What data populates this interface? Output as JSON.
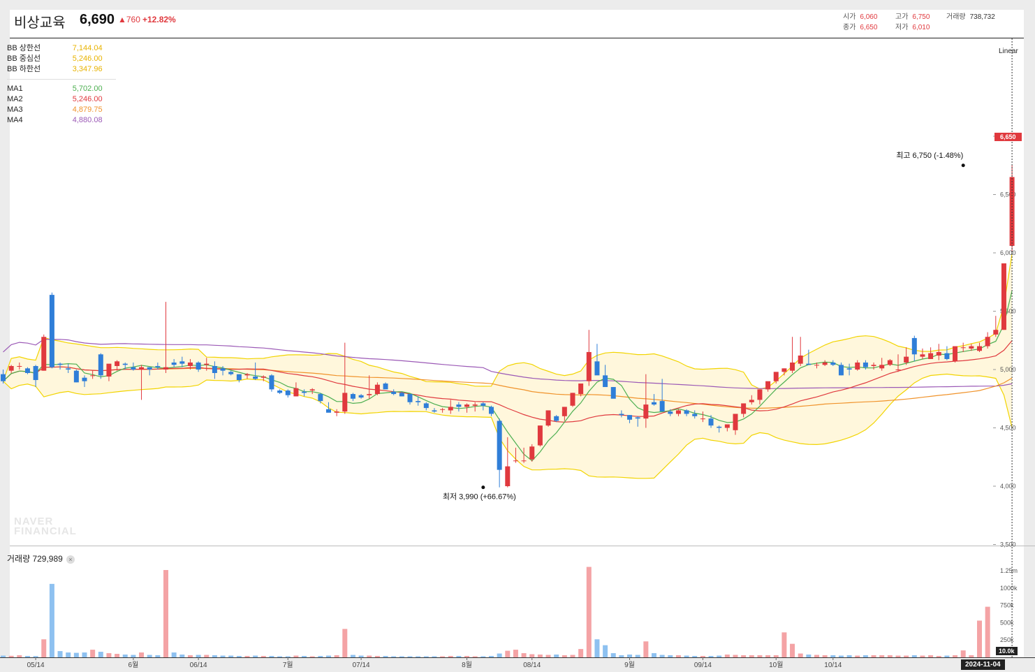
{
  "header": {
    "name": "비상교육",
    "price": "6,690",
    "change": "▲760",
    "change_pct": "+12.82%",
    "open_label": "시가",
    "open": "6,060",
    "high_label": "고가",
    "high": "6,750",
    "volume_label": "거래량",
    "volume": "738,732",
    "close_label": "종가",
    "close": "6,650",
    "low_label": "저가",
    "low": "6,010"
  },
  "legend": {
    "bb": [
      {
        "label": "BB 상한선",
        "value": "7,144.04",
        "color": "#e8b300"
      },
      {
        "label": "BB 중심선",
        "value": "5,246.00",
        "color": "#e8b300"
      },
      {
        "label": "BB 하한선",
        "value": "3,347.96",
        "color": "#e8b300"
      }
    ],
    "ma": [
      {
        "label": "MA1",
        "value": "5,702.00",
        "color": "#4caf50"
      },
      {
        "label": "MA2",
        "value": "5,246.00",
        "color": "#e0393e"
      },
      {
        "label": "MA3",
        "value": "4,879.75",
        "color": "#f0932b"
      },
      {
        "label": "MA4",
        "value": "4,880.08",
        "color": "#9b59b6"
      }
    ]
  },
  "scale_label": "Linear",
  "volume_panel": {
    "title": "거래량 729,989",
    "close": "×"
  },
  "watermark": [
    "NAVER",
    "FINANCIAL"
  ],
  "date_tag": "2024-11-04",
  "vol_tag": "10.0k",
  "price_tag": "6,650",
  "colors": {
    "up": "#e0393e",
    "down": "#2f7ed8",
    "up_vol": "#f4a3a5",
    "down_vol": "#8ec1f0",
    "bb": "#f2d400",
    "bb_fill": "#fff7dc"
  },
  "chart_data": {
    "type": "candlestick",
    "y_ticks": [
      "7,000",
      "6,500",
      "6,000",
      "5,500",
      "5,000",
      "4,500",
      "4,000",
      "3,500"
    ],
    "y_tick_values": [
      7000,
      6500,
      6000,
      5500,
      5000,
      4500,
      4000,
      3500
    ],
    "x_ticks": [
      "05/14",
      "6월",
      "06/14",
      "7월",
      "07/14",
      "8월",
      "08/14",
      "9월",
      "09/14",
      "10월",
      "10/14"
    ],
    "x_tick_index": [
      4,
      16,
      24,
      35,
      44,
      57,
      65,
      77,
      86,
      95,
      102
    ],
    "vol_ticks": [
      "1.25m",
      "1000k",
      "750k",
      "500k",
      "250k"
    ],
    "vol_tick_values": [
      1250000,
      1000000,
      750000,
      500000,
      250000
    ],
    "annotations": [
      {
        "text": "최고 6,750 (-1.48%)",
        "index": 118,
        "value": 6750
      },
      {
        "text": "최저 3,990 (+66.67%)",
        "index": 59,
        "value": 3990
      }
    ],
    "candles": [
      [
        4960,
        5000,
        4880,
        4900
      ],
      [
        4990,
        5040,
        4970,
        5030
      ],
      [
        5030,
        5060,
        5000,
        5030
      ],
      [
        5010,
        5020,
        4960,
        4970
      ],
      [
        5030,
        5040,
        4850,
        4910
      ],
      [
        4990,
        5300,
        4990,
        5280
      ],
      [
        5640,
        5660,
        5010,
        5020
      ],
      [
        5050,
        5060,
        5000,
        5040
      ],
      [
        5010,
        5050,
        4970,
        5000
      ],
      [
        4990,
        5000,
        4890,
        4890
      ],
      [
        4930,
        4950,
        4850,
        4900
      ],
      [
        4950,
        4990,
        4920,
        4950
      ],
      [
        5130,
        5140,
        4920,
        4950
      ],
      [
        4940,
        5040,
        4900,
        5050
      ],
      [
        5030,
        5080,
        4990,
        5070
      ],
      [
        5050,
        5060,
        5000,
        5040
      ],
      [
        5020,
        5060,
        4990,
        5000
      ],
      [
        5000,
        5040,
        4740,
        5020
      ],
      [
        5020,
        5020,
        4950,
        5000
      ],
      [
        5030,
        5060,
        5000,
        5020
      ],
      [
        5000,
        5580,
        4970,
        5020
      ],
      [
        5060,
        5090,
        5020,
        5040
      ],
      [
        5070,
        5110,
        5020,
        5050
      ],
      [
        5030,
        5090,
        5000,
        5060
      ],
      [
        5060,
        5070,
        4980,
        5000
      ],
      [
        5040,
        5100,
        4990,
        5050
      ],
      [
        5030,
        5070,
        4920,
        4970
      ],
      [
        5010,
        5030,
        4950,
        4990
      ],
      [
        4980,
        4990,
        4950,
        4960
      ],
      [
        4960,
        4960,
        4890,
        4910
      ],
      [
        4950,
        4970,
        4920,
        4960
      ],
      [
        4940,
        5060,
        4910,
        4920
      ],
      [
        4930,
        4950,
        4900,
        4940
      ],
      [
        4950,
        4960,
        4810,
        4830
      ],
      [
        4820,
        4830,
        4790,
        4800
      ],
      [
        4820,
        4830,
        4760,
        4780
      ],
      [
        4770,
        4890,
        4770,
        4840
      ],
      [
        4810,
        4830,
        4770,
        4800
      ],
      [
        4820,
        4840,
        4790,
        4830
      ],
      [
        4790,
        4800,
        4710,
        4730
      ],
      [
        4660,
        4720,
        4640,
        4630
      ],
      [
        4630,
        4660,
        4600,
        4640
      ],
      [
        4640,
        5230,
        4620,
        4800
      ],
      [
        4790,
        4800,
        4730,
        4750
      ],
      [
        4780,
        4790,
        4750,
        4760
      ],
      [
        4780,
        4950,
        4750,
        4790
      ],
      [
        4790,
        4890,
        4780,
        4870
      ],
      [
        4880,
        4890,
        4840,
        4830
      ],
      [
        4810,
        4830,
        4780,
        4790
      ],
      [
        4800,
        4810,
        4770,
        4770
      ],
      [
        4790,
        4790,
        4700,
        4720
      ],
      [
        4730,
        4770,
        4690,
        4720
      ],
      [
        4710,
        4720,
        4650,
        4670
      ],
      [
        4650,
        4670,
        4630,
        4640
      ],
      [
        4660,
        4670,
        4630,
        4660
      ],
      [
        4650,
        4740,
        4620,
        4680
      ],
      [
        4700,
        4720,
        4640,
        4680
      ],
      [
        4680,
        4710,
        4630,
        4700
      ],
      [
        4690,
        4720,
        4640,
        4700
      ],
      [
        4710,
        4720,
        4650,
        4690
      ],
      [
        4680,
        4690,
        4600,
        4620
      ],
      [
        4560,
        4580,
        3990,
        4140
      ],
      [
        4000,
        4420,
        3990,
        4170
      ],
      [
        4220,
        4330,
        4200,
        4220
      ],
      [
        4220,
        4330,
        4200,
        4220
      ],
      [
        4230,
        4360,
        4210,
        4340
      ],
      [
        4350,
        4520,
        4340,
        4520
      ],
      [
        4520,
        4650,
        4510,
        4650
      ],
      [
        4600,
        4610,
        4550,
        4560
      ],
      [
        4600,
        4680,
        4560,
        4680
      ],
      [
        4690,
        4800,
        4680,
        4800
      ],
      [
        4790,
        4870,
        4770,
        4880
      ],
      [
        4900,
        5340,
        4860,
        5150
      ],
      [
        5070,
        5220,
        4970,
        4950
      ],
      [
        4950,
        5040,
        4890,
        4850
      ],
      [
        4850,
        4850,
        4760,
        4750
      ],
      [
        4620,
        4650,
        4590,
        4610
      ],
      [
        4610,
        4610,
        4540,
        4570
      ],
      [
        4590,
        4600,
        4510,
        4580
      ],
      [
        4580,
        4960,
        4500,
        4700
      ],
      [
        4720,
        4790,
        4690,
        4700
      ],
      [
        4730,
        4920,
        4690,
        4640
      ],
      [
        4640,
        4660,
        4600,
        4620
      ],
      [
        4620,
        4660,
        4600,
        4650
      ],
      [
        4650,
        4660,
        4600,
        4620
      ],
      [
        4620,
        4650,
        4580,
        4600
      ],
      [
        4580,
        4640,
        4550,
        4580
      ],
      [
        4580,
        4610,
        4500,
        4520
      ],
      [
        4510,
        4520,
        4460,
        4500
      ],
      [
        4500,
        4530,
        4470,
        4530
      ],
      [
        4480,
        4610,
        4440,
        4620
      ],
      [
        4620,
        4690,
        4590,
        4710
      ],
      [
        4720,
        4780,
        4700,
        4740
      ],
      [
        4740,
        4800,
        4700,
        4830
      ],
      [
        4830,
        4880,
        4810,
        4900
      ],
      [
        4900,
        4960,
        4880,
        4980
      ],
      [
        4980,
        5010,
        4950,
        5010
      ],
      [
        4990,
        5280,
        4970,
        5060
      ],
      [
        5050,
        5280,
        5030,
        5120
      ],
      [
        5050,
        5170,
        5040,
        5040
      ],
      [
        5040,
        5060,
        5010,
        5040
      ],
      [
        5040,
        5080,
        5030,
        5060
      ],
      [
        5060,
        5080,
        5030,
        5040
      ],
      [
        5040,
        5060,
        4950,
        4950
      ],
      [
        5010,
        5050,
        4950,
        5000
      ],
      [
        5000,
        5080,
        4990,
        5060
      ],
      [
        5060,
        5080,
        5000,
        5020
      ],
      [
        5030,
        5060,
        5000,
        5040
      ],
      [
        5010,
        5100,
        4990,
        5040
      ],
      [
        5040,
        5090,
        5030,
        5080
      ],
      [
        5000,
        5130,
        4980,
        5000
      ],
      [
        5060,
        5190,
        5040,
        5110
      ],
      [
        5270,
        5290,
        5070,
        5130
      ],
      [
        5110,
        5180,
        5090,
        5130
      ],
      [
        5090,
        5190,
        5090,
        5140
      ],
      [
        5120,
        5220,
        5080,
        5150
      ],
      [
        5140,
        5200,
        5080,
        5090
      ],
      [
        5070,
        5140,
        5060,
        5200
      ],
      [
        5190,
        5230,
        5150,
        5190
      ],
      [
        5180,
        5220,
        5160,
        5200
      ],
      [
        5160,
        5230,
        5150,
        5200
      ],
      [
        5200,
        5320,
        5180,
        5280
      ],
      [
        5300,
        5460,
        5280,
        5340
      ],
      [
        5340,
        5900,
        5340,
        5910
      ],
      [
        6060,
        6750,
        6010,
        6650
      ]
    ],
    "volume": [
      25000,
      22000,
      30000,
      20000,
      18000,
      260000,
      1060000,
      90000,
      70000,
      65000,
      70000,
      110000,
      80000,
      60000,
      50000,
      40000,
      35000,
      70000,
      35000,
      30000,
      1260000,
      70000,
      40000,
      30000,
      35000,
      35000,
      30000,
      25000,
      25000,
      20000,
      20000,
      25000,
      20000,
      20000,
      15000,
      15000,
      25000,
      20000,
      15000,
      20000,
      25000,
      30000,
      410000,
      35000,
      25000,
      25000,
      20000,
      20000,
      15000,
      15000,
      15000,
      15000,
      15000,
      15000,
      15000,
      20000,
      20000,
      20000,
      15000,
      15000,
      20000,
      55000,
      95000,
      110000,
      60000,
      45000,
      40000,
      35000,
      40000,
      30000,
      35000,
      120000,
      1305000,
      260000,
      175000,
      60000,
      30000,
      40000,
      35000,
      230000,
      60000,
      35000,
      30000,
      30000,
      25000,
      20000,
      20000,
      20000,
      25000,
      40000,
      35000,
      30000,
      30000,
      30000,
      30000,
      30000,
      360000,
      195000,
      55000,
      40000,
      35000,
      30000,
      30000,
      25000,
      30000,
      25000,
      30000,
      30000,
      30000,
      30000,
      25000,
      25000,
      30000,
      25000,
      30000,
      20000,
      25000,
      30000,
      100000,
      30000,
      530000,
      730000
    ]
  }
}
